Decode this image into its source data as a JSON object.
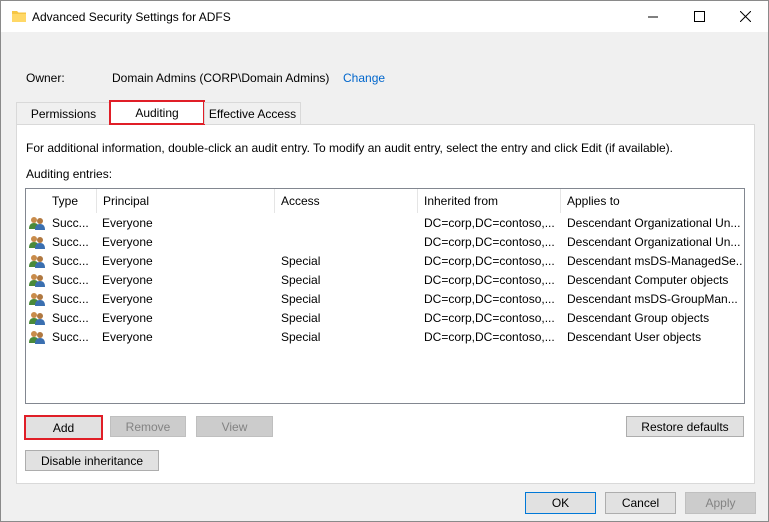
{
  "window": {
    "title": "Advanced Security Settings for ADFS",
    "folder_icon_color": "#f6c644"
  },
  "owner": {
    "label": "Owner:",
    "value": "Domain Admins (CORP\\Domain Admins)",
    "change_link": "Change"
  },
  "tabs": [
    {
      "label": "Permissions"
    },
    {
      "label": "Auditing",
      "selected": true
    },
    {
      "label": "Effective Access"
    }
  ],
  "auditing": {
    "info_text": "For additional information, double-click an audit entry. To modify an audit entry, select the entry and click Edit (if available).",
    "entries_label": "Auditing entries:",
    "columns": [
      "Type",
      "Principal",
      "Access",
      "Inherited from",
      "Applies to"
    ],
    "rows": [
      {
        "type": "Succ...",
        "principal": "Everyone",
        "access": "",
        "inherited_from": "DC=corp,DC=contoso,...",
        "applies_to": "Descendant Organizational Un..."
      },
      {
        "type": "Succ...",
        "principal": "Everyone",
        "access": "",
        "inherited_from": "DC=corp,DC=contoso,...",
        "applies_to": "Descendant Organizational Un..."
      },
      {
        "type": "Succ...",
        "principal": "Everyone",
        "access": "Special",
        "inherited_from": "DC=corp,DC=contoso,...",
        "applies_to": "Descendant msDS-ManagedSe..."
      },
      {
        "type": "Succ...",
        "principal": "Everyone",
        "access": "Special",
        "inherited_from": "DC=corp,DC=contoso,...",
        "applies_to": "Descendant Computer objects"
      },
      {
        "type": "Succ...",
        "principal": "Everyone",
        "access": "Special",
        "inherited_from": "DC=corp,DC=contoso,...",
        "applies_to": "Descendant msDS-GroupMan..."
      },
      {
        "type": "Succ...",
        "principal": "Everyone",
        "access": "Special",
        "inherited_from": "DC=corp,DC=contoso,...",
        "applies_to": "Descendant Group objects"
      },
      {
        "type": "Succ...",
        "principal": "Everyone",
        "access": "Special",
        "inherited_from": "DC=corp,DC=contoso,...",
        "applies_to": "Descendant User objects"
      }
    ],
    "row_icon": "users-icon"
  },
  "buttons": {
    "add": "Add",
    "remove": "Remove",
    "view": "View",
    "restore_defaults": "Restore defaults",
    "disable_inheritance": "Disable inheritance",
    "ok": "OK",
    "cancel": "Cancel",
    "apply": "Apply"
  },
  "colors": {
    "highlight_red": "#e01e27",
    "link_blue": "#0066cc",
    "focus_blue": "#0078d7"
  }
}
